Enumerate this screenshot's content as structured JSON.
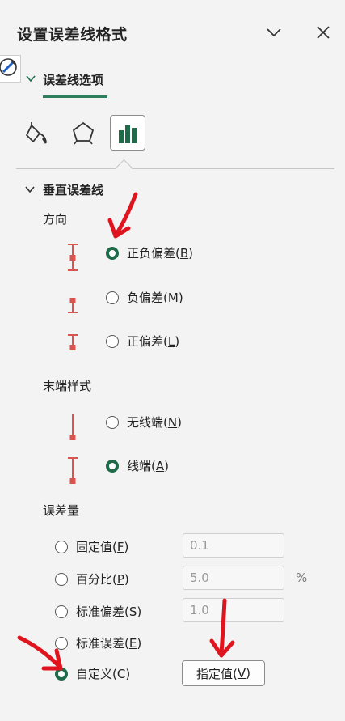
{
  "pane": {
    "title": "设置误差线格式",
    "collapse_icon": "chevron-down-icon",
    "close_icon": "close-icon"
  },
  "tab": {
    "label": "误差线选项"
  },
  "icon_tabs": [
    {
      "name": "fill-bucket-icon",
      "selected": false
    },
    {
      "name": "pentagon-effects-icon",
      "selected": false
    },
    {
      "name": "bar-chart-options-icon",
      "selected": true
    }
  ],
  "section": {
    "title": "垂直误差线"
  },
  "direction": {
    "label": "方向",
    "options": [
      {
        "text": "正负偏差(",
        "key": "B",
        "tail": ")",
        "checked": true
      },
      {
        "text": "负偏差(",
        "key": "M",
        "tail": ")",
        "checked": false
      },
      {
        "text": "正偏差(",
        "key": "L",
        "tail": ")",
        "checked": false
      }
    ]
  },
  "end_style": {
    "label": "末端样式",
    "options": [
      {
        "text": "无线端(",
        "key": "N",
        "tail": ")",
        "checked": false
      },
      {
        "text": "线端(",
        "key": "A",
        "tail": ")",
        "checked": true
      }
    ]
  },
  "amount": {
    "label": "误差量",
    "options": [
      {
        "text": "固定值(",
        "key": "F",
        "tail": ")",
        "value": "0.1",
        "unit": "",
        "checked": false
      },
      {
        "text": "百分比(",
        "key": "P",
        "tail": ")",
        "value": "5.0",
        "unit": "%",
        "checked": false
      },
      {
        "text": "标准偏差(",
        "key": "S",
        "tail": ")",
        "value": "1.0",
        "unit": "",
        "checked": false
      },
      {
        "text": "标准误差(",
        "key": "E",
        "tail": ")",
        "checked": false
      },
      {
        "text": "自定义(C)",
        "checked": true
      }
    ],
    "specify_button": {
      "text": "指定值(",
      "key": "V",
      "tail": ")"
    }
  },
  "colors": {
    "accent_green": "#1e6b4a",
    "errorbar_red": "#d9534f",
    "annotation_arrow": "#e0141e"
  }
}
